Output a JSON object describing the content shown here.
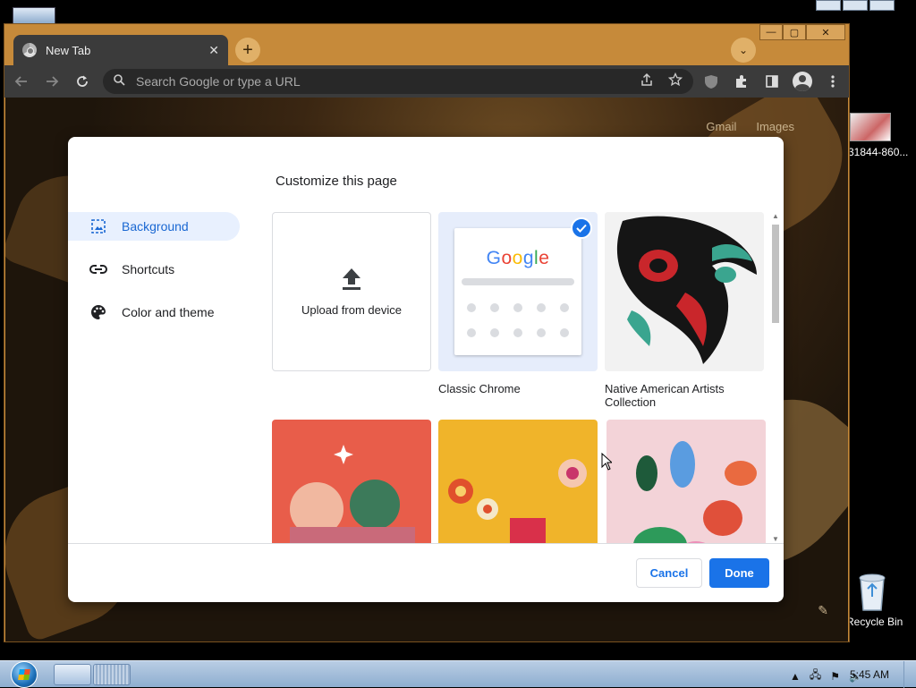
{
  "desktop": {
    "photo_label": "31844-860...",
    "recycle_label": "Recycle Bin"
  },
  "browser": {
    "tab_title": "New Tab",
    "tab_close": "✕",
    "new_tab": "+",
    "tab_search": "⌄",
    "window_controls": {
      "minimize": "—",
      "maximize": "▢",
      "close": "✕"
    },
    "omnibox_placeholder": "Search Google or type a URL"
  },
  "ntp": {
    "links": [
      "Gmail",
      "Images"
    ]
  },
  "dialog": {
    "title": "Customize this page",
    "menu": [
      {
        "label": "Background",
        "icon": "image-icon",
        "active": true
      },
      {
        "label": "Shortcuts",
        "icon": "link-icon",
        "active": false
      },
      {
        "label": "Color and theme",
        "icon": "palette-icon",
        "active": false
      }
    ],
    "tiles": {
      "upload_label": "Upload from device",
      "classic_label": "Classic Chrome",
      "classic_logo": "Google",
      "native_label": "Native American Artists Collection"
    },
    "cancel": "Cancel",
    "done": "Done"
  },
  "taskbar": {
    "time": "5:45 AM"
  },
  "colors": {
    "accent": "#1a73e8",
    "frame": "#c68a3a",
    "toolbar": "#3b3b3b"
  }
}
